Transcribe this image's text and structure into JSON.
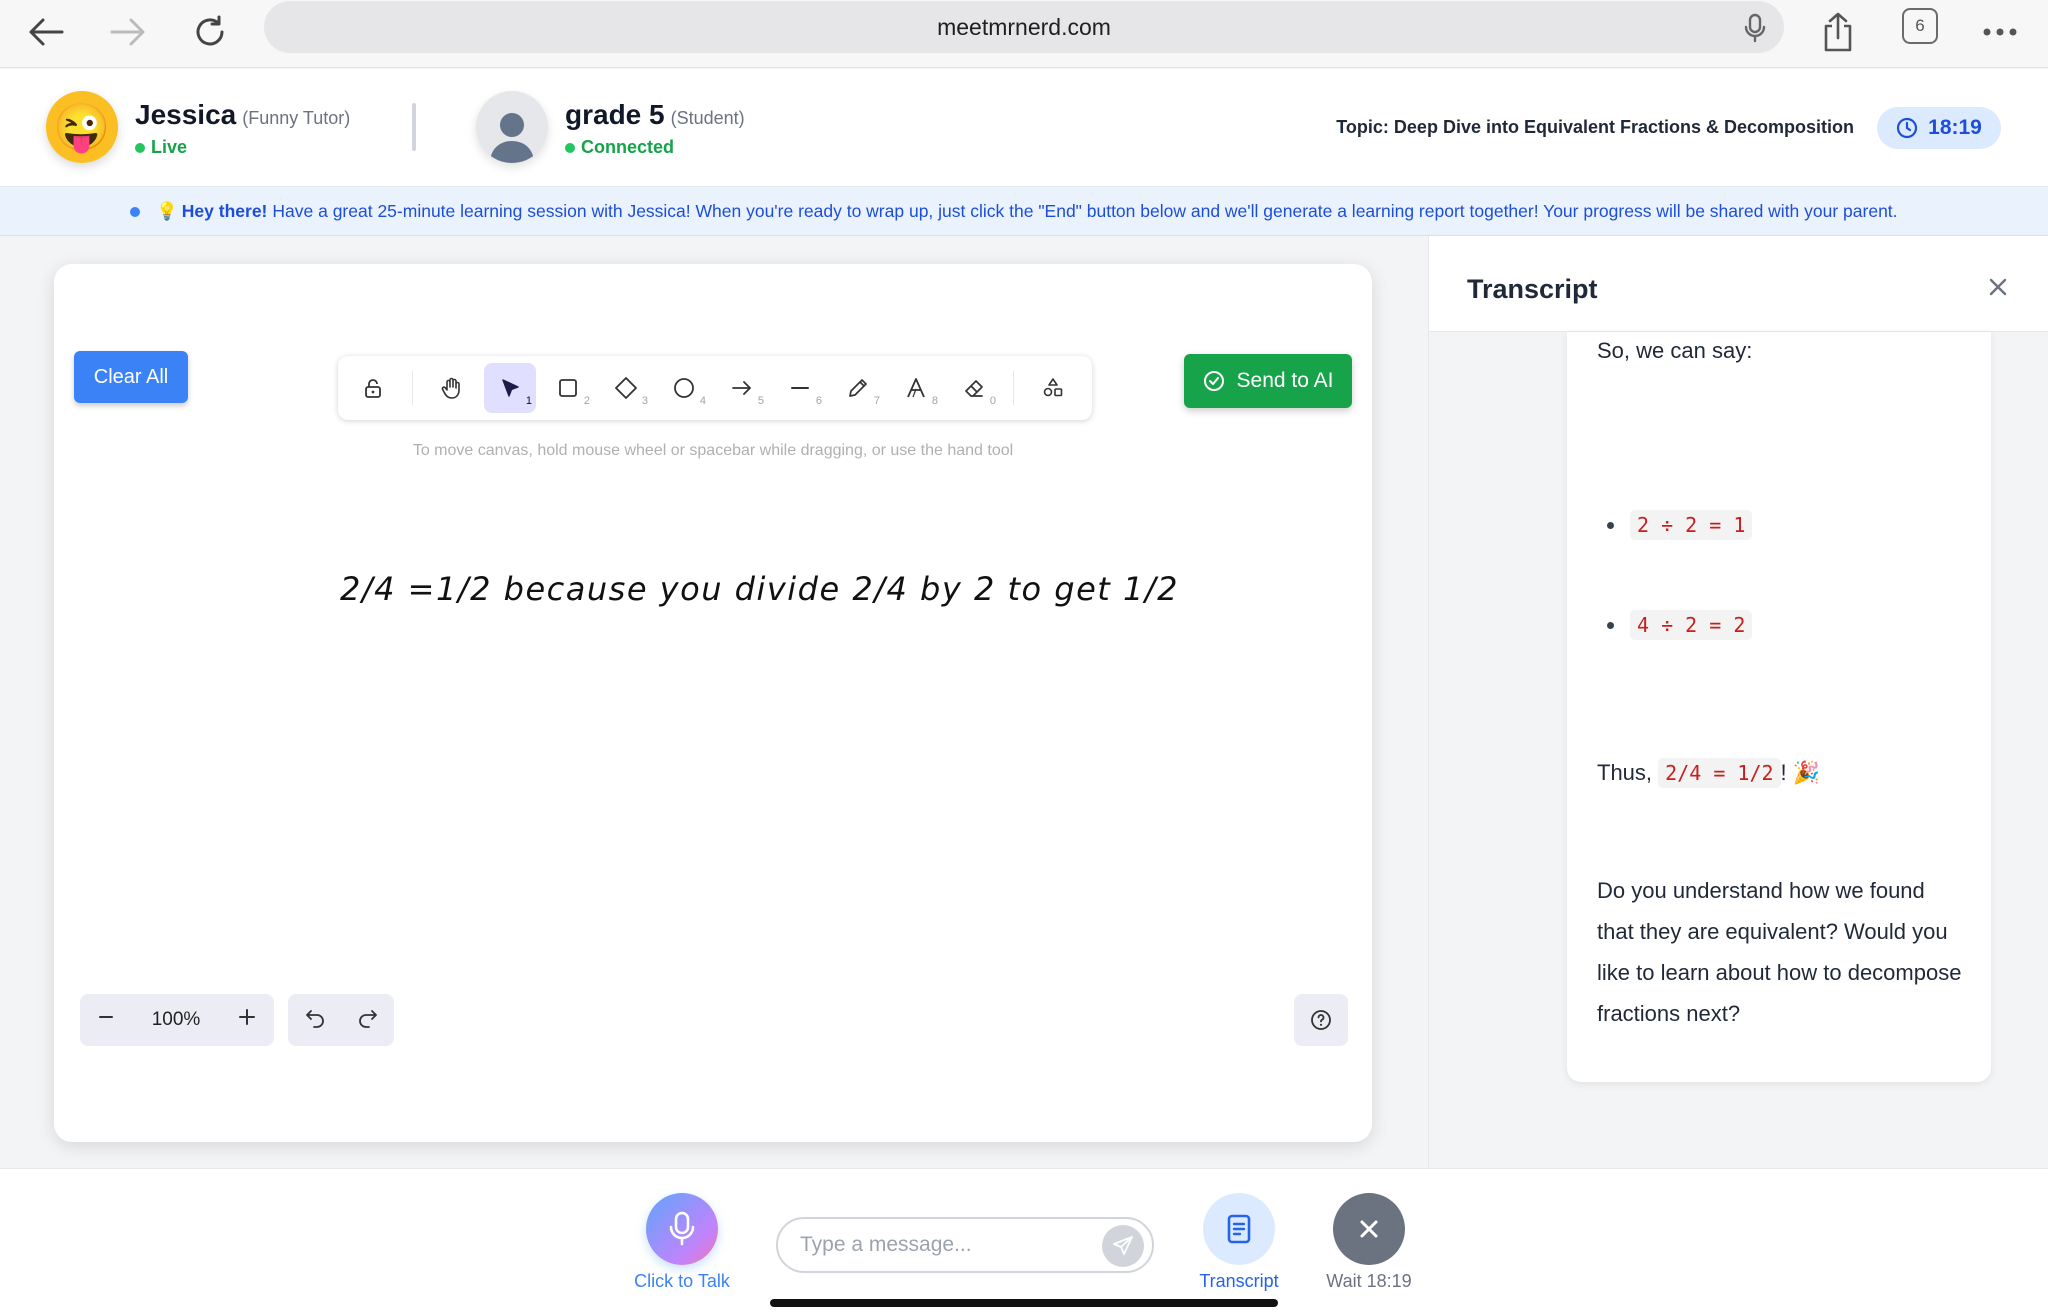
{
  "browser": {
    "url": "meetmrnerd.com",
    "tab_count": "6"
  },
  "tutor": {
    "name": "Jessica",
    "role": "(Funny Tutor)",
    "status": "Live",
    "avatar_emoji": "😜"
  },
  "student": {
    "name": "grade 5",
    "role": "(Student)",
    "status": "Connected"
  },
  "topic": "Topic: Deep Dive into Equivalent Fractions & Decomposition",
  "timer": "18:19",
  "banner": {
    "emoji": "💡",
    "bold": "Hey there!",
    "text": "Have a great 25-minute learning session with Jessica! When you're ready to wrap up, just click the \"End\" button below and we'll generate a learning report together! Your progress will be shared with your parent."
  },
  "canvas": {
    "clear_label": "Clear All",
    "send_label": "Send to AI",
    "hint": "To move canvas, hold mouse wheel or spacebar while dragging, or use the hand tool",
    "handwriting": "2/4 =1/2 because you divide 2/4 by 2 to get 1/2",
    "zoom": "100%",
    "tool_numbers": {
      "select": "1",
      "rectangle": "2",
      "diamond": "3",
      "ellipse": "4",
      "arrow": "5",
      "line": "6",
      "pencil": "7",
      "text": "8",
      "eraser": "0"
    }
  },
  "transcript": {
    "title": "Transcript",
    "line1": "So, we can say:",
    "bullet1": "2 ÷ 2 = 1",
    "bullet2": "4 ÷ 2 = 2",
    "thus_prefix": "Thus,",
    "thus_code": "2/4 = 1/2",
    "thus_suffix": "!",
    "thus_emoji": "🎉",
    "question": "Do you understand how we found that they are equivalent? Would you like to learn about how to decompose fractions next?"
  },
  "bottom": {
    "talk_label": "Click to Talk",
    "message_placeholder": "Type a message...",
    "transcript_label": "Transcript",
    "wait_label": "Wait 18:19"
  }
}
